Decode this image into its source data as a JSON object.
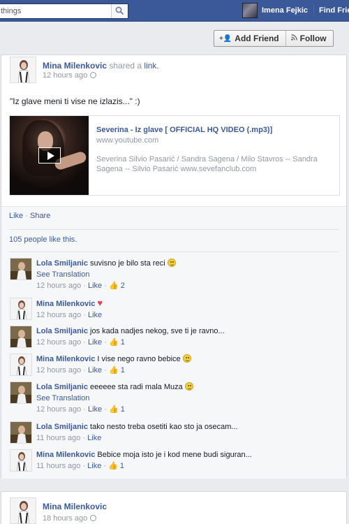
{
  "topbar": {
    "search_value": "things",
    "profile_name": "Imena Fejkic",
    "find_friends": "Find Frie"
  },
  "header": {
    "add_friend": "Add Friend",
    "follow": "Follow"
  },
  "post": {
    "author": "Mina Milenkovic",
    "action_text": "shared a",
    "action_link": "link.",
    "time": "12 hours ago",
    "status": "\"Iz glave meni ti vise ne izlazis...\" :)",
    "share": {
      "title": "Severina - Iz glave [ OFFICIAL HQ VIDEO (.mp3)]",
      "url": "www.youtube.com",
      "description": "Severina Silvio Pasarić / Sandra Sagena / Milo Stavros -- Sandra Sagena -- Silvio Pasarić www.sevefanclub.com"
    },
    "like_label": "Like",
    "share_label": "Share",
    "likes_summary": "105 people like this.",
    "comments": [
      {
        "name": "Lola Smiljanic",
        "text": "suvisno je bilo sta reci",
        "emoji": "smile",
        "translate": "See Translation",
        "time": "12 hours ago",
        "like": "Like",
        "count": "2",
        "pic": "lola"
      },
      {
        "name": "Mina Milenkovic",
        "text": "",
        "emoji": "heart",
        "translate": "",
        "time": "12 hours ago",
        "like": "Like",
        "count": "",
        "pic": "mina"
      },
      {
        "name": "Lola Smiljanic",
        "text": "jos kada nadjes nekog, sve ti je ravno...",
        "emoji": "",
        "translate": "",
        "time": "12 hours ago",
        "like": "Like",
        "count": "1",
        "pic": "lola"
      },
      {
        "name": "Mina Milenkovic",
        "text": "I vise nego ravno bebice",
        "emoji": "smile",
        "translate": "",
        "time": "12 hours ago",
        "like": "Like",
        "count": "1",
        "pic": "mina"
      },
      {
        "name": "Lola Smiljanic",
        "text": "eeeeee sta radi mala Muza",
        "emoji": "smile",
        "translate": "See Translation",
        "time": "12 hours ago",
        "like": "Like",
        "count": "1",
        "pic": "lola"
      },
      {
        "name": "Lola Smiljanic",
        "text": "tako nesto treba osetiti kao sto ja osecam...",
        "emoji": "",
        "translate": "",
        "time": "11 hours ago",
        "like": "Like",
        "count": "",
        "pic": "lola"
      },
      {
        "name": "Mina Milenkovic",
        "text": "Bebice moja isto je i kod mene budi siguran...",
        "emoji": "",
        "translate": "",
        "time": "11 hours ago",
        "like": "Like",
        "count": "1",
        "pic": "mina"
      }
    ]
  },
  "post2": {
    "author": "Mina Milenkovic",
    "time": "18 hours ago"
  }
}
